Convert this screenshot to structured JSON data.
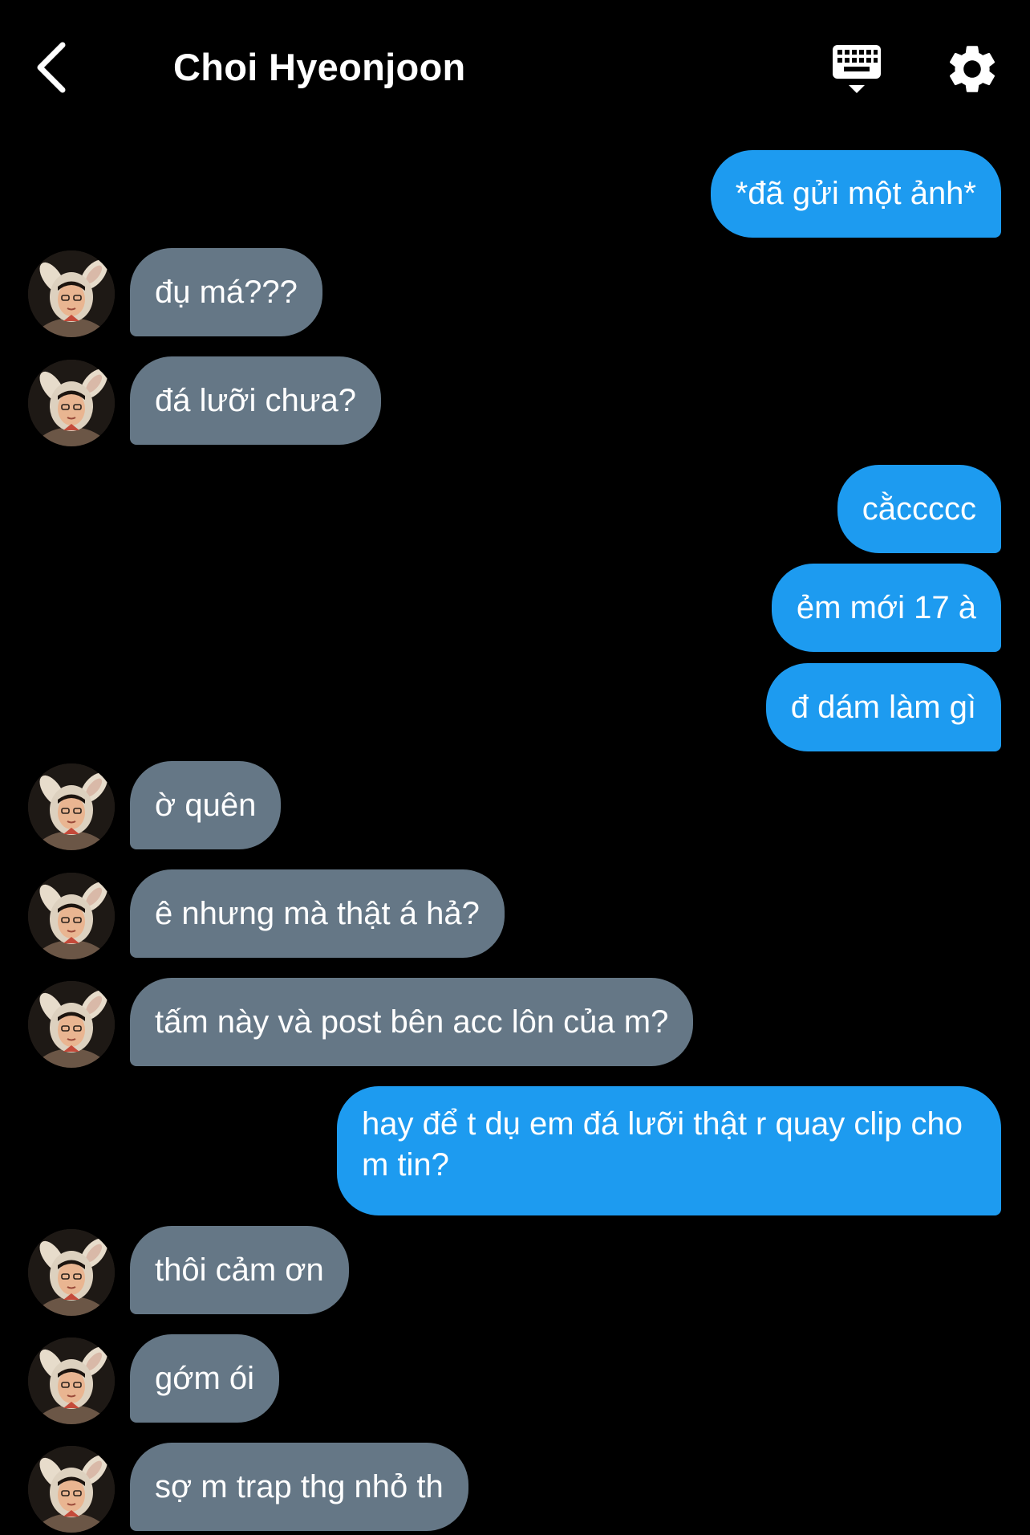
{
  "header": {
    "title": "Choi Hyeonjoon",
    "back_icon": "chevron-left-icon",
    "keyboard_icon": "keyboard-icon",
    "settings_icon": "gear-icon"
  },
  "colors": {
    "background": "#000000",
    "outgoing_bubble": "#1d9bf0",
    "incoming_bubble": "#657786",
    "text": "#ffffff"
  },
  "messages": [
    {
      "direction": "out",
      "text": "*đã gửi một ảnh*"
    },
    {
      "direction": "in",
      "text": "đụ má???"
    },
    {
      "direction": "in",
      "text": "đá lưỡi chưa?"
    },
    {
      "direction": "out",
      "text": "cằccccc"
    },
    {
      "direction": "out",
      "text": "ẻm mới 17 à"
    },
    {
      "direction": "out",
      "text": "đ dám làm gì"
    },
    {
      "direction": "in",
      "text": "ờ quên"
    },
    {
      "direction": "in",
      "text": "ê nhưng mà thật á hả?"
    },
    {
      "direction": "in",
      "text": "tấm này và post bên acc lôn của m?"
    },
    {
      "direction": "out",
      "text": "hay để t dụ em đá lưỡi thật r quay clip cho m tin?"
    },
    {
      "direction": "in",
      "text": "thôi cảm ơn"
    },
    {
      "direction": "in",
      "text": "gớm ói"
    },
    {
      "direction": "in",
      "text": "sợ m trap thg nhỏ th"
    }
  ]
}
